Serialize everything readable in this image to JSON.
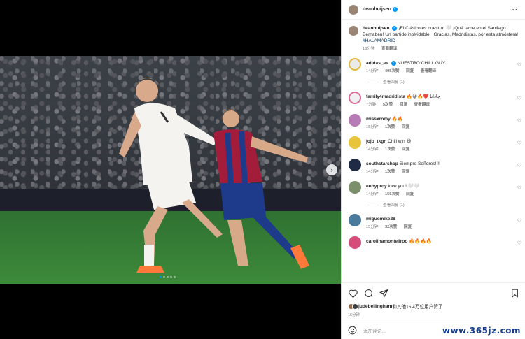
{
  "post": {
    "username": "deanhuijsen",
    "caption_user": "deanhuijsen",
    "caption": "¡El Clásico es nuestro! 🤍 ¡Qué tarde en el Santiago Bernabéu! Un partido inolvidable. ¡Gracias, Madridistas, por esta atmósfera!",
    "hashtag": "#HALAMADRID",
    "time": "16分钟",
    "translate": "查看翻译"
  },
  "comments": [
    {
      "user": "adidas_es",
      "text": "NUESTRO CHILL GUY",
      "time": "14分钟",
      "likes": "495次赞",
      "reply": "回复",
      "translate": "查看翻译",
      "view_replies": "查看回复 (1)",
      "avatar_color": "#d8d8d8"
    },
    {
      "user": "family4madridista",
      "text": "🔥😀🔥❤️ جاذانا",
      "time": "7分钟",
      "likes": "5次赞",
      "reply": "回复",
      "translate": "查看翻译",
      "avatar_color": "#e6e6e6"
    },
    {
      "user": "missxromy",
      "text": "🔥🔥",
      "time": "15分钟",
      "likes": "1次赞",
      "reply": "回复",
      "avatar_color": "#b77bb5"
    },
    {
      "user": "jojo_tkgn",
      "text": "Chill win 😆",
      "time": "14分钟",
      "likes": "1次赞",
      "reply": "回复",
      "avatar_color": "#e8c43b"
    },
    {
      "user": "southstarshop",
      "text": "Siempre Señores!!!!",
      "time": "14分钟",
      "likes": "1次赞",
      "reply": "回复",
      "avatar_color": "#1f2a44"
    },
    {
      "user": "enhyproy",
      "text": "love you! 🤍🤍",
      "time": "14分钟",
      "likes": "156次赞",
      "reply": "回复",
      "view_replies": "查看回复 (1)",
      "avatar_color": "#7d8f6a"
    },
    {
      "user": "miguemike28",
      "text": "",
      "time": "15分钟",
      "likes": "32次赞",
      "reply": "回复",
      "avatar_color": "#4a7a9c"
    },
    {
      "user": "carolinamonteiiroo",
      "text": "🔥🔥🔥🔥",
      "time": "",
      "likes": "",
      "reply": "",
      "avatar_color": "#d64d7a"
    }
  ],
  "likes_text_user": "judebellingham",
  "likes_text_rest": "和其他15.4万位用户赞了",
  "likes_time": "16分钟",
  "comment_placeholder": "添加评论...",
  "watermark": "www.365jz.com",
  "colors": {
    "accent": "#0095f6",
    "tag": "#00376b",
    "muted": "#737373"
  }
}
